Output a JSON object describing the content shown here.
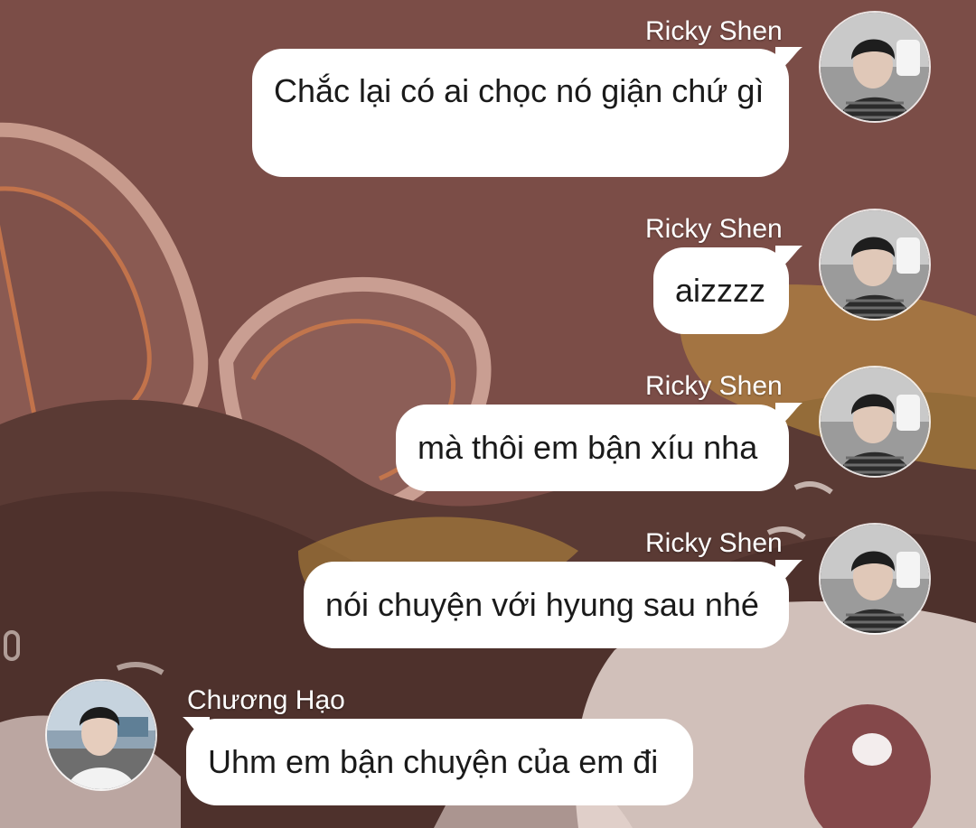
{
  "chat": {
    "messages": [
      {
        "sender": "Ricky Shen",
        "text": "Chắc lại có ai chọc nó giận chứ gì",
        "side": "right"
      },
      {
        "sender": "Ricky Shen",
        "text": "aizzzz",
        "side": "right"
      },
      {
        "sender": "Ricky Shen",
        "text": "mà thôi em bận xíu nha",
        "side": "right"
      },
      {
        "sender": "Ricky Shen",
        "text": "nói chuyện với hyung sau nhé",
        "side": "right"
      },
      {
        "sender": "Chương Hạo",
        "text": "Uhm em bận chuyện của em đi",
        "side": "left"
      }
    ]
  },
  "colors": {
    "background": "#7b4d47",
    "bubble": "#ffffff",
    "name_text": "#ffffff"
  },
  "icons": {
    "ricky_avatar": "avatar-photo",
    "chuong_avatar": "avatar-photo"
  }
}
